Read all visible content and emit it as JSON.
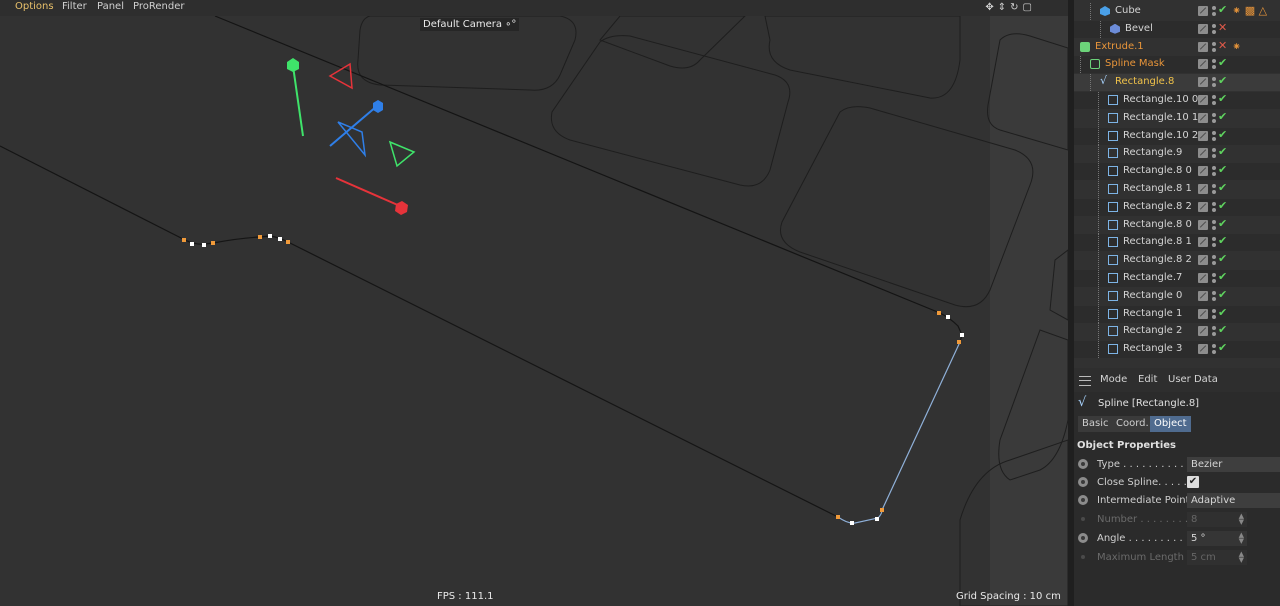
{
  "viewport": {
    "menu": [
      {
        "label": "Options",
        "active": true
      },
      {
        "label": "Filter",
        "active": false
      },
      {
        "label": "Panel",
        "active": false
      },
      {
        "label": "ProRender",
        "active": false
      }
    ],
    "camera_label": "Default Camera",
    "camera_icon": "camera-icon",
    "nav_icons": [
      "move-view-icon",
      "pan-view-icon",
      "rotate-view-icon",
      "maximize-view-icon"
    ],
    "fps": "FPS : 111.1",
    "grid_spacing": "Grid Spacing : 10 cm"
  },
  "object_manager": {
    "rows": [
      {
        "name": "Cube",
        "icon": "cube-icon",
        "status": "check",
        "extra": "texture-tags"
      },
      {
        "name": "Bevel",
        "icon": "bevel-icon",
        "status": "x",
        "extra": ""
      },
      {
        "name": "Extrude.1",
        "icon": "extrude-icon",
        "status": "x",
        "extra": "phong-tag",
        "color": "orange"
      },
      {
        "name": "Spline Mask",
        "icon": "spline-mask-icon",
        "status": "check",
        "extra": "",
        "color": "orange"
      },
      {
        "name": "Rectangle.8",
        "icon": "spline-icon",
        "status": "check",
        "extra": "",
        "color": "yellow",
        "selected": true
      },
      {
        "name": "Rectangle.10 0",
        "icon": "rectangle-icon",
        "status": "check"
      },
      {
        "name": "Rectangle.10 1",
        "icon": "rectangle-icon",
        "status": "check"
      },
      {
        "name": "Rectangle.10 2",
        "icon": "rectangle-icon",
        "status": "check"
      },
      {
        "name": "Rectangle.9",
        "icon": "rectangle-icon",
        "status": "check"
      },
      {
        "name": "Rectangle.8 0",
        "icon": "rectangle-icon",
        "status": "check"
      },
      {
        "name": "Rectangle.8 1",
        "icon": "rectangle-icon",
        "status": "check"
      },
      {
        "name": "Rectangle.8 2",
        "icon": "rectangle-icon",
        "status": "check"
      },
      {
        "name": "Rectangle.8 0",
        "icon": "rectangle-icon",
        "status": "check"
      },
      {
        "name": "Rectangle.8 1",
        "icon": "rectangle-icon",
        "status": "check"
      },
      {
        "name": "Rectangle.8 2",
        "icon": "rectangle-icon",
        "status": "check"
      },
      {
        "name": "Rectangle.7",
        "icon": "rectangle-icon",
        "status": "check"
      },
      {
        "name": "Rectangle 0",
        "icon": "rectangle-icon",
        "status": "check"
      },
      {
        "name": "Rectangle 1",
        "icon": "rectangle-icon",
        "status": "check"
      },
      {
        "name": "Rectangle 2",
        "icon": "rectangle-icon",
        "status": "check"
      },
      {
        "name": "Rectangle 3",
        "icon": "rectangle-icon",
        "status": "check"
      }
    ]
  },
  "attribute_manager": {
    "menu": [
      "Mode",
      "Edit",
      "User Data"
    ],
    "title": "Spline [Rectangle.8]",
    "tabs": [
      {
        "label": "Basic",
        "active": false
      },
      {
        "label": "Coord.",
        "active": false
      },
      {
        "label": "Object",
        "active": true
      }
    ],
    "section": "Object Properties",
    "properties": {
      "type_label": "Type . . . . . . . . . .",
      "type_value": "Bezier",
      "close_label": "Close Spline. . . . .",
      "close_value": "✔",
      "intermediate_label": "Intermediate Points",
      "intermediate_value": "Adaptive",
      "number_label": "Number . . . . . . . .",
      "number_value": "8",
      "angle_label": "Angle . . . . . . . . .",
      "angle_value": "5 °",
      "maxlen_label": "Maximum Length",
      "maxlen_value": "5 cm"
    }
  },
  "colors": {
    "axis_x": "#e6333a",
    "axis_y": "#3fe36a",
    "axis_z": "#2f7fe8",
    "point_orange": "#f09a3a",
    "point_white": "#ffffff",
    "spline_blue": "#8fb0d8",
    "active_menu": "#e8c06a",
    "selected_object": "#f0c24a",
    "tab_active": "#4f6b8f"
  }
}
